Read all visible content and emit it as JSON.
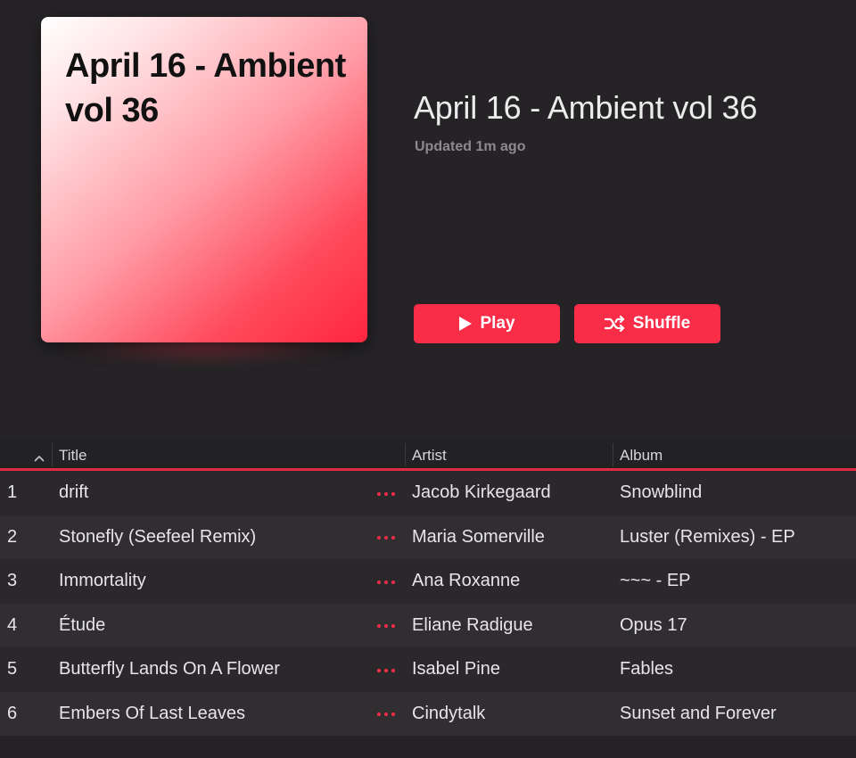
{
  "artwork": {
    "text": "April 16 - Ambient vol 36"
  },
  "header": {
    "title": "April 16 - Ambient vol 36",
    "updated": "Updated 1m ago"
  },
  "actions": {
    "play_label": "Play",
    "shuffle_label": "Shuffle"
  },
  "colors": {
    "accent": "#fa2d48",
    "background": "#252326"
  },
  "table": {
    "columns": {
      "title": "Title",
      "artist": "Artist",
      "album": "Album"
    },
    "sort": "ascending",
    "rows": [
      {
        "num": "1",
        "title": "drift",
        "artist": "Jacob Kirkegaard",
        "album": "Snowblind"
      },
      {
        "num": "2",
        "title": "Stonefly (Seefeel Remix)",
        "artist": "Maria Somerville",
        "album": "Luster (Remixes) - EP"
      },
      {
        "num": "3",
        "title": "Immortality",
        "artist": "Ana Roxanne",
        "album": "~~~ - EP"
      },
      {
        "num": "4",
        "title": "Étude",
        "artist": "Eliane Radigue",
        "album": "Opus 17"
      },
      {
        "num": "5",
        "title": "Butterfly Lands On A Flower",
        "artist": "Isabel Pine",
        "album": "Fables"
      },
      {
        "num": "6",
        "title": "Embers Of Last Leaves",
        "artist": "Cindytalk",
        "album": "Sunset and Forever"
      }
    ]
  }
}
